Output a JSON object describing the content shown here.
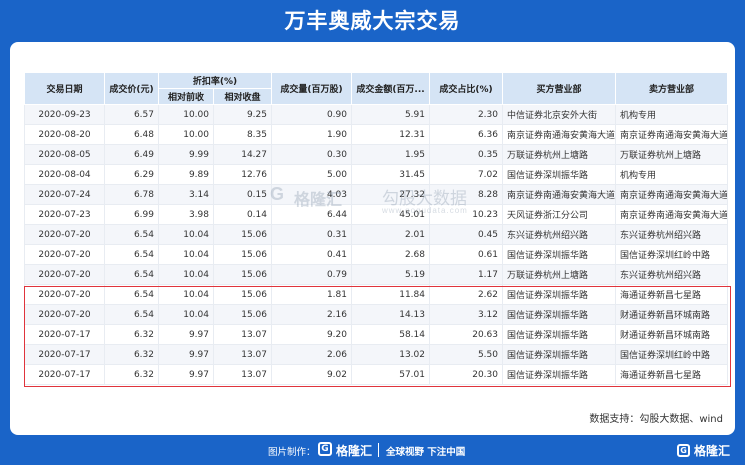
{
  "title": "万丰奥威大宗交易",
  "columns": {
    "date": "交易日期",
    "price": "成交价(元)",
    "discount_group": "折扣率(%)",
    "discount_prev": "相对前收",
    "discount_close": "相对收盘",
    "volume": "成交量(百万股)",
    "amount": "成交金额(百万...",
    "ratio": "成交占比(%)",
    "buyer": "买方营业部",
    "seller": "卖方营业部"
  },
  "rows": [
    {
      "date": "2020-09-23",
      "price": "6.57",
      "prev": "10.00",
      "close": "9.25",
      "volume": "0.90",
      "amount": "5.91",
      "ratio": "2.30",
      "buyer": "中信证券北京安外大街",
      "seller": "机构专用"
    },
    {
      "date": "2020-08-20",
      "price": "6.48",
      "prev": "10.00",
      "close": "8.35",
      "volume": "1.90",
      "amount": "12.31",
      "ratio": "6.36",
      "buyer": "南京证券南通海安黄海大道",
      "seller": "南京证券南通海安黄海大道"
    },
    {
      "date": "2020-08-05",
      "price": "6.49",
      "prev": "9.99",
      "close": "14.27",
      "volume": "0.30",
      "amount": "1.95",
      "ratio": "0.35",
      "buyer": "万联证券杭州上塘路",
      "seller": "万联证券杭州上塘路"
    },
    {
      "date": "2020-08-04",
      "price": "6.29",
      "prev": "9.89",
      "close": "12.76",
      "volume": "5.00",
      "amount": "31.45",
      "ratio": "7.02",
      "buyer": "国信证券深圳振华路",
      "seller": "机构专用"
    },
    {
      "date": "2020-07-24",
      "price": "6.78",
      "prev": "3.14",
      "close": "0.15",
      "volume": "4.03",
      "amount": "27.32",
      "ratio": "8.28",
      "buyer": "南京证券南通海安黄海大道",
      "seller": "南京证券南通海安黄海大道"
    },
    {
      "date": "2020-07-23",
      "price": "6.99",
      "prev": "3.98",
      "close": "0.14",
      "volume": "6.44",
      "amount": "45.01",
      "ratio": "10.23",
      "buyer": "天风证券浙江分公司",
      "seller": "南京证券南通海安黄海大道"
    },
    {
      "date": "2020-07-20",
      "price": "6.54",
      "prev": "10.04",
      "close": "15.06",
      "volume": "0.31",
      "amount": "2.01",
      "ratio": "0.45",
      "buyer": "东兴证券杭州绍兴路",
      "seller": "东兴证券杭州绍兴路"
    },
    {
      "date": "2020-07-20",
      "price": "6.54",
      "prev": "10.04",
      "close": "15.06",
      "volume": "0.41",
      "amount": "2.68",
      "ratio": "0.61",
      "buyer": "国信证券深圳振华路",
      "seller": "国信证券深圳红岭中路"
    },
    {
      "date": "2020-07-20",
      "price": "6.54",
      "prev": "10.04",
      "close": "15.06",
      "volume": "0.79",
      "amount": "5.19",
      "ratio": "1.17",
      "buyer": "万联证券杭州上塘路",
      "seller": "东兴证券杭州绍兴路"
    },
    {
      "date": "2020-07-20",
      "price": "6.54",
      "prev": "10.04",
      "close": "15.06",
      "volume": "1.81",
      "amount": "11.84",
      "ratio": "2.62",
      "buyer": "国信证券深圳振华路",
      "seller": "海通证券新昌七星路"
    },
    {
      "date": "2020-07-20",
      "price": "6.54",
      "prev": "10.04",
      "close": "15.06",
      "volume": "2.16",
      "amount": "14.13",
      "ratio": "3.12",
      "buyer": "国信证券深圳振华路",
      "seller": "财通证券新昌环城南路"
    },
    {
      "date": "2020-07-17",
      "price": "6.32",
      "prev": "9.97",
      "close": "13.07",
      "volume": "9.20",
      "amount": "58.14",
      "ratio": "20.63",
      "buyer": "国信证券深圳振华路",
      "seller": "财通证券新昌环城南路"
    },
    {
      "date": "2020-07-17",
      "price": "6.32",
      "prev": "9.97",
      "close": "13.07",
      "volume": "2.06",
      "amount": "13.02",
      "ratio": "5.50",
      "buyer": "国信证券深圳振华路",
      "seller": "国信证券深圳红岭中路"
    },
    {
      "date": "2020-07-17",
      "price": "6.32",
      "prev": "9.97",
      "close": "13.07",
      "volume": "9.02",
      "amount": "57.01",
      "ratio": "20.30",
      "buyer": "国信证券深圳振华路",
      "seller": "海通证券新昌七星路"
    }
  ],
  "watermark": {
    "logo_text": "格隆汇",
    "right_text": "勾股大数据",
    "url": "www.gogudata.com"
  },
  "source": "数据支持：勾股大数据、wind",
  "footer": {
    "credit": "图片制作：",
    "logo_text": "格隆汇",
    "slogan": "全球视野 下注中国",
    "corner_text": "格隆汇"
  },
  "colors": {
    "background": "#1a64c8",
    "header": "#d5e4f5",
    "highlight_border": "#e0343c"
  }
}
